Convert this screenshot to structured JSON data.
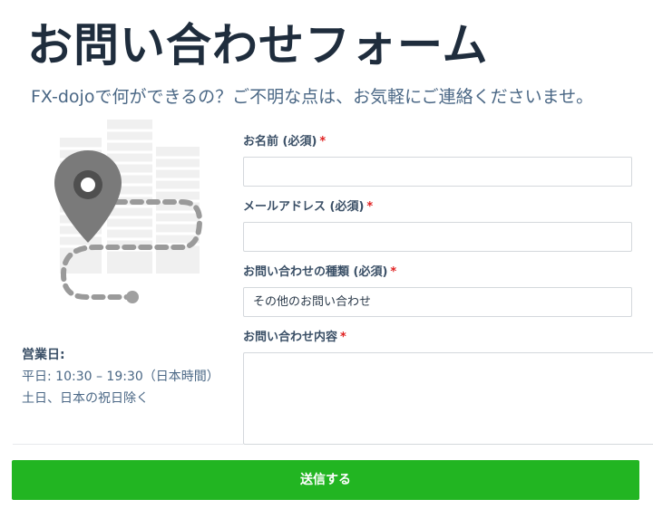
{
  "header": {
    "title": "お問い合わせフォーム",
    "subtitle": "FX-dojoで何ができるの？ご不明な点は、お気軽にご連絡くださいませ。"
  },
  "illustration": {
    "icon": "map-pin-route-icon"
  },
  "business_hours": {
    "title": "営業日:",
    "weekday": "平日: 10:30 – 19:30（日本時間）",
    "closed": "土日、日本の祝日除く"
  },
  "form": {
    "required_mark": "*",
    "fields": [
      {
        "label": "お名前 (必須)",
        "value": ""
      },
      {
        "label": "メールアドレス (必須)",
        "value": ""
      },
      {
        "label": "お問い合わせの種類 (必須)",
        "value": "その他のお問い合わせ"
      },
      {
        "label": "お問い合わせ内容",
        "value": ""
      }
    ],
    "submit_label": "送信する"
  },
  "colors": {
    "accent": "#22b522",
    "required": "#e02020",
    "title": "#1f2d3d",
    "text": "#4a6785"
  }
}
